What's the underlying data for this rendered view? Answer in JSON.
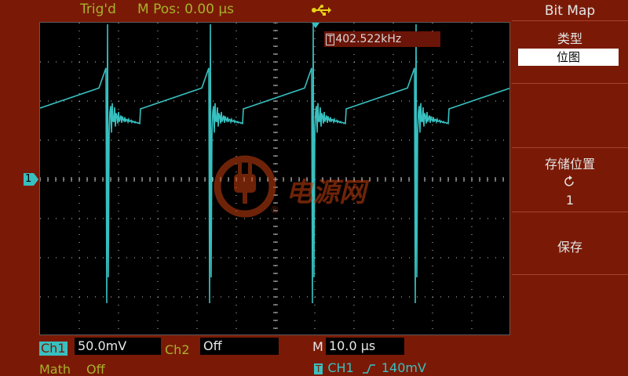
{
  "header": {
    "trigger_status": "Trig'd",
    "m_pos": "M Pos: 0.00 μs",
    "usb_icon": "usb-icon"
  },
  "measurement": {
    "freq_icon": "T",
    "frequency": "402.522kHz"
  },
  "channel_marker": "1",
  "watermark_text": "电源网",
  "bottom": {
    "ch1_label": "Ch1",
    "ch1_scale": "50.0mV",
    "ch2_label": "Ch2",
    "ch2_value": "Off",
    "time_label": "M",
    "time_scale": "10.0 μs",
    "math_label": "Math",
    "math_value": "Off",
    "trigger_icon": "T",
    "trigger_source": "CH1",
    "trigger_slope_icon": "rising-edge-icon",
    "trigger_level": "140mV"
  },
  "menu": {
    "title": "Bit Map",
    "type_label": "类型",
    "type_value": "位图",
    "location_label": "存储位置",
    "location_icon": "rotate-icon",
    "location_value": "1",
    "save_label": "保存"
  },
  "colors": {
    "background": "#7a1a06",
    "trace": "#38c0c0",
    "status_text": "#a9b02c",
    "grid": "#c8c8c8"
  }
}
